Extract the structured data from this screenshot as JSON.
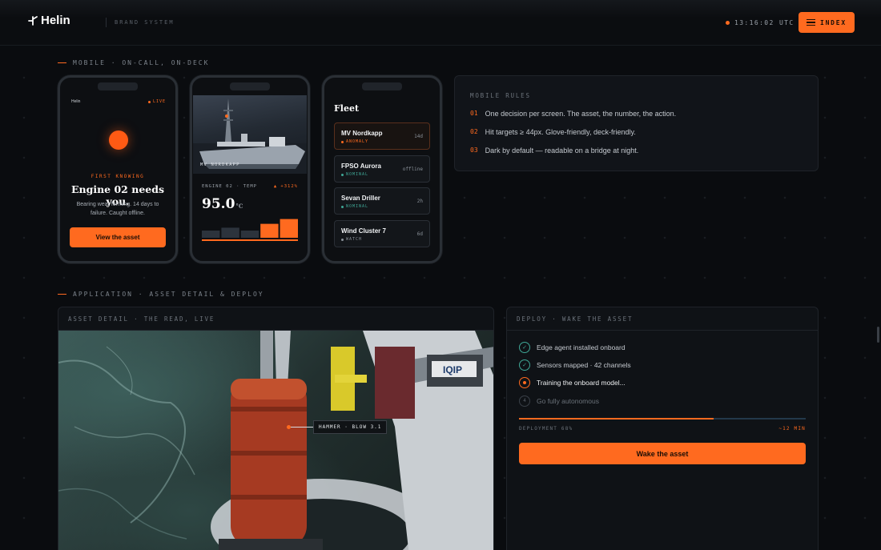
{
  "header": {
    "logo_text": "Helin",
    "brand_system": "BRAND SYSTEM",
    "clock": "13:16:02 UTC",
    "index_label": "INDEX"
  },
  "sections": {
    "mobile": "MOBILE · ON-CALL, ON-DECK",
    "application": "APPLICATION · ASSET DETAIL & DEPLOY"
  },
  "phone1": {
    "brand": "Helin",
    "live": "LIVE",
    "eyebrow": "FIRST KNOWING",
    "headline": "Engine 02 needs you.",
    "body": "Bearing wear forming. 14 days to failure. Caught offline.",
    "cta": "View the asset"
  },
  "phone2": {
    "caption": "MV NORDKAPP",
    "metric_label": "ENGINE 02 · TEMP",
    "delta": "▲ +312%",
    "value": "95.0",
    "unit": "°C",
    "bars": [
      0.3,
      0.42,
      0.3,
      0.58,
      0.78
    ]
  },
  "phone3": {
    "title": "Fleet",
    "items": [
      {
        "name": "MV Nordkapp",
        "status": "ANOMALY",
        "status_color": "#ff6a1f",
        "right": "14d",
        "active": true
      },
      {
        "name": "FPSO Aurora",
        "status": "NOMINAL",
        "status_color": "#3fa796",
        "right": "offline",
        "active": false
      },
      {
        "name": "Sevan Driller",
        "status": "NOMINAL",
        "status_color": "#3fa796",
        "right": "2h",
        "active": false
      },
      {
        "name": "Wind Cluster 7",
        "status": "WATCH",
        "status_color": "#8a9199",
        "right": "6d",
        "active": false
      }
    ]
  },
  "rules": {
    "title": "MOBILE RULES",
    "items": [
      {
        "num": "01",
        "text": "One decision per screen. The asset, the number, the action."
      },
      {
        "num": "02",
        "text": "Hit targets ≥ 44px. Glove-friendly, deck-friendly."
      },
      {
        "num": "03",
        "text": "Dark by default — readable on a bridge at night."
      }
    ]
  },
  "asset_detail": {
    "title": "ASSET DETAIL · THE READ, LIVE",
    "callout": "HAMMER · BLOW 3.1",
    "sign_text": "IQIP"
  },
  "deploy": {
    "title": "DEPLOY · WAKE THE ASSET",
    "steps": [
      {
        "label": "Edge agent installed onboard",
        "state": "done"
      },
      {
        "label": "Sensors mapped · 42 channels",
        "state": "done"
      },
      {
        "label": "Training the onboard model...",
        "state": "active"
      },
      {
        "label": "Go fully autonomous",
        "state": "todo",
        "num": "4"
      }
    ],
    "progress_label": "DEPLOYMENT 68%",
    "progress": 0.68,
    "eta": "~12 MIN",
    "cta": "Wake the asset"
  },
  "colors": {
    "accent": "#ff6a1f",
    "ok": "#3fa796",
    "background": "#0a0c0f"
  }
}
